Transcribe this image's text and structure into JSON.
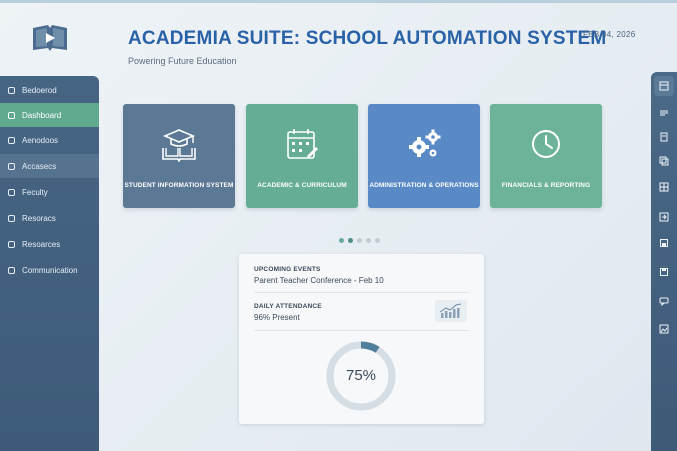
{
  "header": {
    "title": "ACADEMIA SUITE: SCHOOL AUTOMATION SYSTEM",
    "subtitle": "Powering Future Education",
    "date": "FEB 04, 2026"
  },
  "sidebar": {
    "items": [
      {
        "label": "Bedoerod"
      },
      {
        "label": "Dashboard"
      },
      {
        "label": "Aenodoos"
      },
      {
        "label": "Accasecs"
      },
      {
        "label": "Feculty"
      },
      {
        "label": "Resoracs"
      },
      {
        "label": "Resoarces"
      },
      {
        "label": "Communication"
      }
    ]
  },
  "cards": [
    {
      "label": "STUDENT INFORMATION SYSTEM",
      "icon": "graduation-cap-book-icon",
      "color": "#5b7894"
    },
    {
      "label": "ACADEMIC & CURRICULUM",
      "icon": "calendar-icon",
      "color": "#65ae95"
    },
    {
      "label": "ADMINISTRATION & OPERATIONS",
      "icon": "gears-icon",
      "color": "#5a8ac6"
    },
    {
      "label": "FINANCIALS & REPORTING",
      "icon": "clock-icon",
      "color": "#6db39a"
    }
  ],
  "panel": {
    "events_heading": "UPCOMING EVENTS",
    "event_item": "Parent Teacher Conference - Feb 10",
    "attendance_heading": "DAILY ATTENDANCE",
    "attendance_value": "96% Present",
    "progress_label": "75%",
    "progress_fraction": 0.75
  },
  "carousel": {
    "page_count": 5,
    "active_page": 2
  },
  "rail": {
    "icons": [
      "layout-icon",
      "list-icon",
      "document-icon",
      "copy-icon",
      "grid-icon",
      "export-icon",
      "save-icon",
      "disk-icon",
      "chat-icon",
      "image-icon"
    ]
  },
  "colors": {
    "accent": "#2a62a8",
    "sidebar": "#466583",
    "active_item": "#5fa98f",
    "ring_track": "#d5dee4",
    "ring_fill": "#4f7f9a"
  }
}
